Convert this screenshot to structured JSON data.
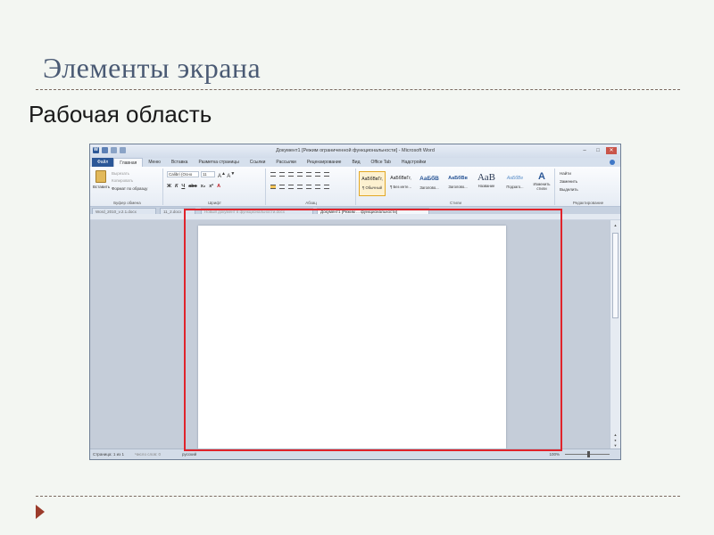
{
  "slide": {
    "title": "Элементы экрана",
    "subtitle": "Рабочая область"
  },
  "window": {
    "title": "Документ1 [Режим ограниченной функциональности] - Microsoft Word"
  },
  "tabs": [
    "Файл",
    "Главная",
    "Меню",
    "Вставка",
    "Разметка страницы",
    "Ссылки",
    "Рассылки",
    "Рецензирование",
    "Вид",
    "Office Tab",
    "Надстройки"
  ],
  "ribbon": {
    "clipboard": {
      "paste": "Вставить",
      "cut": "Вырезать",
      "copy": "Копировать",
      "format_painter": "Формат по образцу",
      "label": "Буфер обмена"
    },
    "font": {
      "name": "Calibri (Осно",
      "size": "11",
      "label": "Шрифт"
    },
    "paragraph": {
      "label": "Абзац"
    },
    "styles": {
      "items": [
        {
          "sample": "АаБбВвГг,",
          "name": "¶ Обычный"
        },
        {
          "sample": "АаБбВвГг,",
          "name": "¶ Без инте..."
        },
        {
          "sample": "АаБбВ",
          "name": "Заголово..."
        },
        {
          "sample": "АаБбВв",
          "name": "Заголово..."
        },
        {
          "sample": "АаВ",
          "name": "Название"
        },
        {
          "sample": "АаБбВе",
          "name": "Подзаго..."
        }
      ],
      "change": "Изменить стили",
      "label": "Стили"
    },
    "editing": {
      "find": "Найти",
      "replace": "Заменить",
      "select": "Выделить",
      "label": "Редактирование"
    }
  },
  "doc_tabs": [
    "Word_2010_v.2.1.docx",
    "11_2.docx",
    "Новый документ в функциональности.docx",
    "Документ1 [Режим ... функциональности]"
  ],
  "status": {
    "page": "Страница: 1 из 1",
    "words": "Число слов: 0",
    "language": "русский",
    "zoom": "100%"
  }
}
